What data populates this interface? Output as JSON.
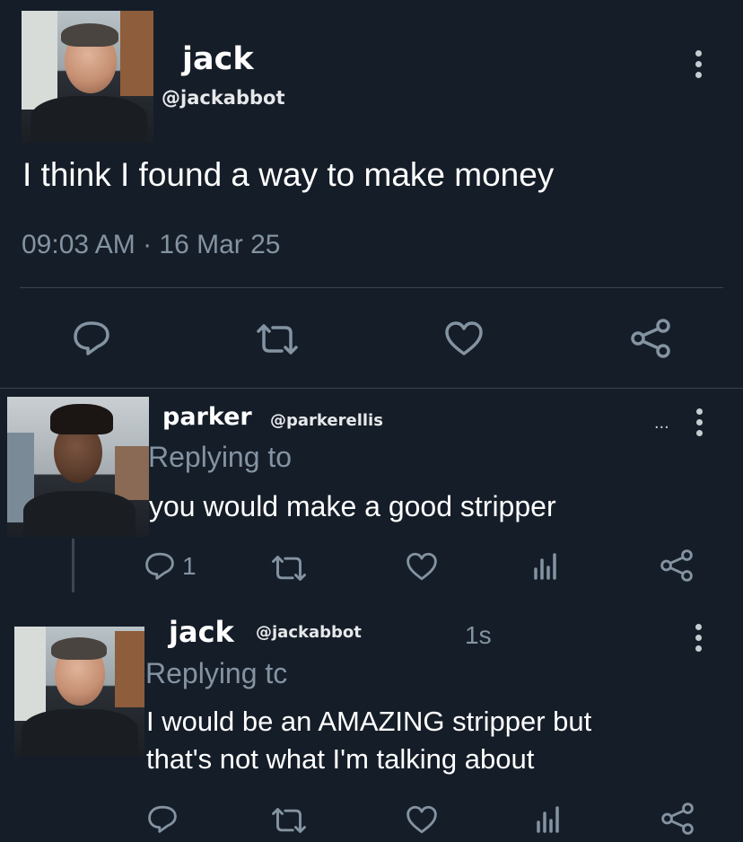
{
  "tweet": {
    "name": "jack",
    "handle": "@jackabbot",
    "text": "I think I found a way to make money",
    "timestamp": "09:03 AM · 16 Mar 25",
    "icons": [
      "reply-icon",
      "retweet-icon",
      "like-icon",
      "share-icon",
      "more-icon"
    ]
  },
  "replies": [
    {
      "name": "parker",
      "handle": "@parkerellis",
      "ellipsis": "...",
      "replying_to": "Replying to",
      "text": "you would make a good stripper",
      "reply_count": "1"
    },
    {
      "name": "jack",
      "handle": "@jackabbot",
      "time": "1s",
      "replying_to": "Replying tc",
      "text_line1": "I would be an AMAZING stripper but",
      "text_line2": "that's not what I'm talking about"
    }
  ],
  "colors": {
    "background": "#151d28",
    "muted": "#8493a2",
    "icon": "#8493a2",
    "divider": "#38444f"
  }
}
